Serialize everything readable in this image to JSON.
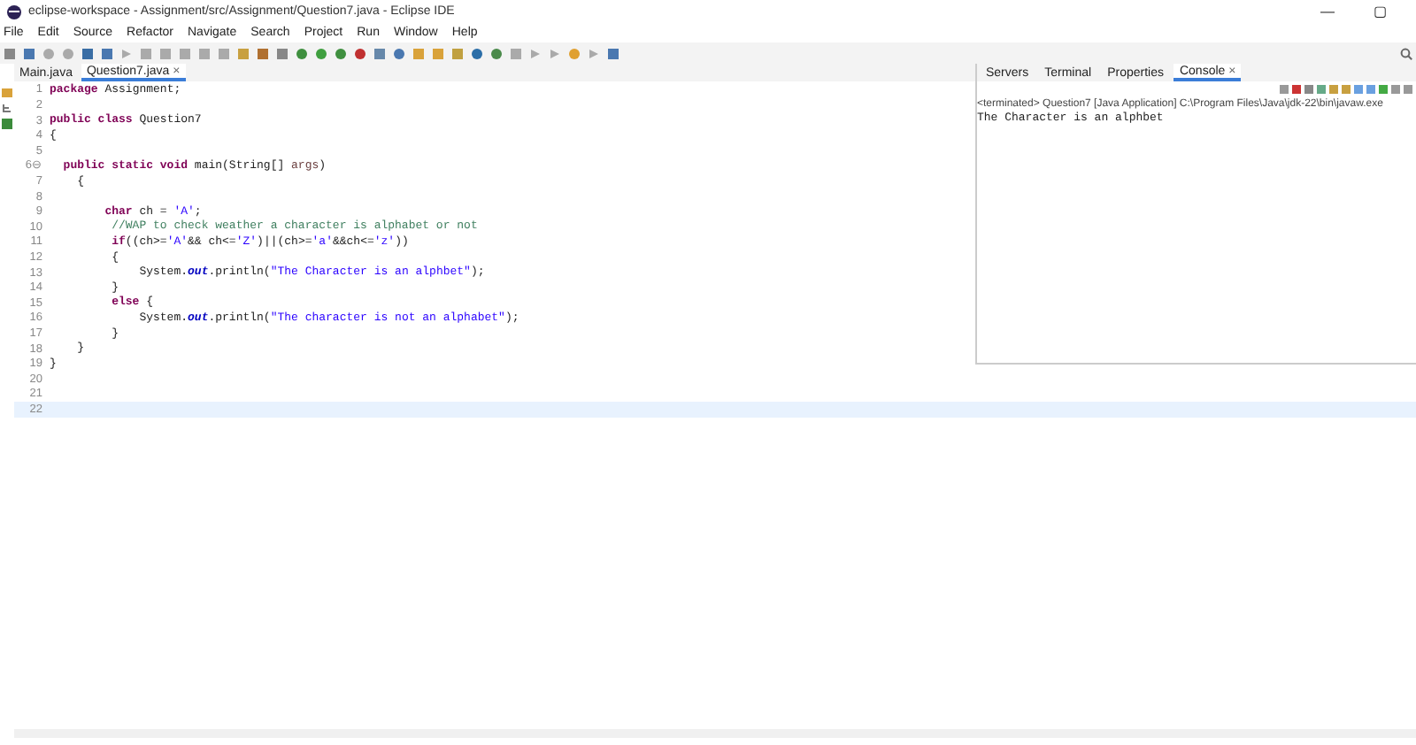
{
  "window": {
    "title": "eclipse-workspace - Assignment/src/Assignment/Question7.java - Eclipse IDE",
    "controls": [
      "—",
      "▢"
    ]
  },
  "menu": [
    "File",
    "Edit",
    "Source",
    "Refactor",
    "Navigate",
    "Search",
    "Project",
    "Run",
    "Window",
    "Help"
  ],
  "editor_tabs": [
    {
      "label": "Main.java",
      "selected": false,
      "closable": false
    },
    {
      "label": "Question7.java",
      "selected": true,
      "closable": true
    }
  ],
  "close_glyph": "×",
  "code": {
    "lines": [
      {
        "number": "1",
        "current": false,
        "segments": [
          {
            "kind": "keyword",
            "text": "package"
          },
          {
            "kind": "plain",
            "text": " Assignment;"
          }
        ]
      },
      {
        "number": "2",
        "current": false
      },
      {
        "number": "3",
        "current": false,
        "segments": [
          {
            "kind": "keyword",
            "text": "public class"
          },
          {
            "kind": "plain",
            "text": " Question7"
          }
        ]
      },
      {
        "number": "4",
        "current": false,
        "segments": [
          {
            "kind": "plain",
            "text": "{"
          }
        ]
      },
      {
        "number": "5",
        "current": false
      },
      {
        "number": "6",
        "fold": "⊖",
        "current": false,
        "segments": [
          {
            "kind": "keyword",
            "text": "  public static void"
          },
          {
            "kind": "plain",
            "text": " main(String[] "
          },
          {
            "kind": "param",
            "text": "args"
          },
          {
            "kind": "plain",
            "text": ")"
          }
        ]
      },
      {
        "number": "7",
        "current": false,
        "segments": [
          {
            "kind": "plain",
            "text": "    {"
          }
        ]
      },
      {
        "number": "8",
        "current": false
      },
      {
        "number": "9",
        "current": false,
        "segments": [
          {
            "kind": "keyword",
            "text": "        char"
          },
          {
            "kind": "plain",
            "text": " ch = "
          },
          {
            "kind": "string",
            "text": "'A'"
          },
          {
            "kind": "plain",
            "text": ";"
          }
        ]
      },
      {
        "number": "10",
        "current": false,
        "segments": [
          {
            "kind": "comment",
            "text": "         //WAP to check weather a character is alphabet or not"
          }
        ]
      },
      {
        "number": "11",
        "current": false,
        "segments": [
          {
            "kind": "keyword",
            "text": "         if"
          },
          {
            "kind": "plain",
            "text": "((ch>="
          },
          {
            "kind": "string",
            "text": "'A'"
          },
          {
            "kind": "plain",
            "text": "&& ch<="
          },
          {
            "kind": "string",
            "text": "'Z'"
          },
          {
            "kind": "plain",
            "text": ")||(ch>="
          },
          {
            "kind": "string",
            "text": "'a'"
          },
          {
            "kind": "plain",
            "text": "&&ch<="
          },
          {
            "kind": "string",
            "text": "'z'"
          },
          {
            "kind": "plain",
            "text": "))"
          }
        ]
      },
      {
        "number": "12",
        "current": false,
        "segments": [
          {
            "kind": "plain",
            "text": "         {"
          }
        ]
      },
      {
        "number": "13",
        "current": false,
        "segments": [
          {
            "kind": "plain",
            "text": "             System."
          },
          {
            "kind": "field",
            "text": "out"
          },
          {
            "kind": "plain",
            "text": ".println("
          },
          {
            "kind": "string",
            "text": "\"The Character is an alphbet\""
          },
          {
            "kind": "plain",
            "text": ");"
          }
        ]
      },
      {
        "number": "14",
        "current": false,
        "segments": [
          {
            "kind": "plain",
            "text": "         }"
          }
        ]
      },
      {
        "number": "15",
        "current": false,
        "segments": [
          {
            "kind": "keyword",
            "text": "         else"
          },
          {
            "kind": "plain",
            "text": " {"
          }
        ]
      },
      {
        "number": "16",
        "current": false,
        "segments": [
          {
            "kind": "plain",
            "text": "             System."
          },
          {
            "kind": "field",
            "text": "out"
          },
          {
            "kind": "plain",
            "text": ".println("
          },
          {
            "kind": "string",
            "text": "\"The character is not an alphabet\""
          },
          {
            "kind": "plain",
            "text": ");"
          }
        ]
      },
      {
        "number": "17",
        "current": false,
        "segments": [
          {
            "kind": "plain",
            "text": "         }"
          }
        ]
      },
      {
        "number": "18",
        "current": false,
        "segments": [
          {
            "kind": "plain",
            "text": "    }"
          }
        ]
      },
      {
        "number": "19",
        "current": false,
        "segments": [
          {
            "kind": "plain",
            "text": "}"
          }
        ]
      },
      {
        "number": "20",
        "current": false
      },
      {
        "number": "21",
        "current": false
      },
      {
        "number": "22",
        "current": true
      }
    ]
  },
  "view_tabs": [
    {
      "label": "Servers",
      "selected": false,
      "closable": false
    },
    {
      "label": "Terminal",
      "selected": false,
      "closable": false
    },
    {
      "label": "Properties",
      "selected": false,
      "closable": false
    },
    {
      "label": "Console",
      "selected": true,
      "closable": true
    }
  ],
  "console": {
    "header": "<terminated> Question7 [Java Application] C:\\Program Files\\Java\\jdk-22\\bin\\javaw.exe",
    "output": "The Character is an alphbet"
  }
}
